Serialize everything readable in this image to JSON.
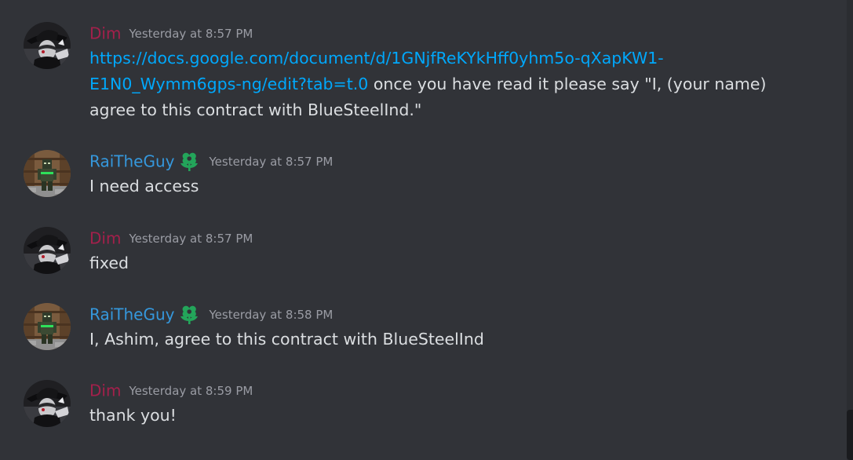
{
  "messages": [
    {
      "author": "Dim",
      "timestamp": "Yesterday at 8:57 PM",
      "link_line1": "https://docs.google.com/document/d/1GNjfReKYkHff0yhm5o-qXapKW1-",
      "link_line2": "E1N0_Wymm6gps-ng/edit?tab=t.0",
      "text_after_link": " once you have read it please say \"I, (your name)",
      "text_line3": "agree to this contract with BlueSteelInd.\""
    },
    {
      "author": "RaiTheGuy",
      "timestamp": "Yesterday at 8:57 PM",
      "text": "I need access"
    },
    {
      "author": "Dim",
      "timestamp": "Yesterday at 8:57 PM",
      "text": "fixed"
    },
    {
      "author": "RaiTheGuy",
      "timestamp": "Yesterday at 8:58 PM",
      "text": "I, Ashim, agree to this contract with BlueSteelInd"
    },
    {
      "author": "Dim",
      "timestamp": "Yesterday at 8:59 PM",
      "text": "thank you!"
    }
  ],
  "icons": {
    "badge": "flower-badge-icon",
    "dim_avatar": "avatar-dim-icon",
    "rai_avatar": "avatar-rai-icon"
  },
  "colors": {
    "background": "#313338",
    "dim_name": "#a3204b",
    "rai_name": "#3598dd",
    "link": "#00a8fc",
    "text": "#dbdee1",
    "timestamp": "#9a9ca4",
    "badge": "#23a55a"
  }
}
